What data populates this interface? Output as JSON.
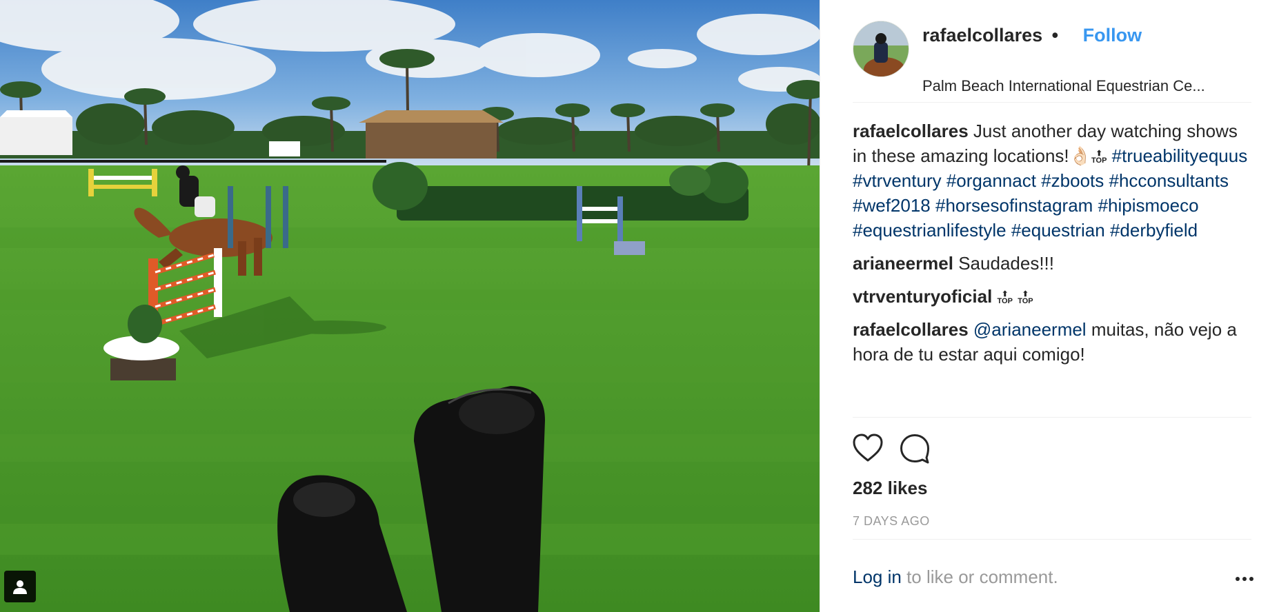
{
  "post": {
    "username": "rafaelcollares",
    "separator": "•",
    "follow_label": "Follow",
    "location": "Palm Beach International Equestrian Ce..."
  },
  "comments": [
    {
      "user": "rafaelcollares",
      "text": "Just another day watching shows in these amazing locations!👌🏻",
      "emoji": "TOP",
      "hashtags": [
        "#trueabilityequus",
        "#vtrventury",
        "#organnact",
        "#zboots",
        "#hcconsultants",
        "#wef2018",
        "#horsesofinstagram",
        "#hipismoeco",
        "#equestrianlifestyle",
        "#equestrian",
        "#derbyfield"
      ]
    },
    {
      "user": "arianeermel",
      "text": "Saudades!!!"
    },
    {
      "user": "vtrventuryoficial",
      "emoji_1": "TOP",
      "emoji_2": "TOP"
    },
    {
      "user": "rafaelcollares",
      "mention": "@arianeermel",
      "text": "muitas, não vejo a hora de tu estar aqui comigo!"
    }
  ],
  "engagement": {
    "likes": "282 likes",
    "time": "7 DAYS AGO"
  },
  "footer": {
    "login_label": "Log in",
    "login_suffix": "to like or comment."
  },
  "icons": {
    "like": "heart-icon",
    "comment": "comment-icon",
    "more": "more-options-icon",
    "tagged_user": "user-tag-icon"
  },
  "colors": {
    "link_blue": "#3897f0",
    "hashtag_blue": "#003569",
    "muted_gray": "#999999",
    "text": "#262626"
  }
}
